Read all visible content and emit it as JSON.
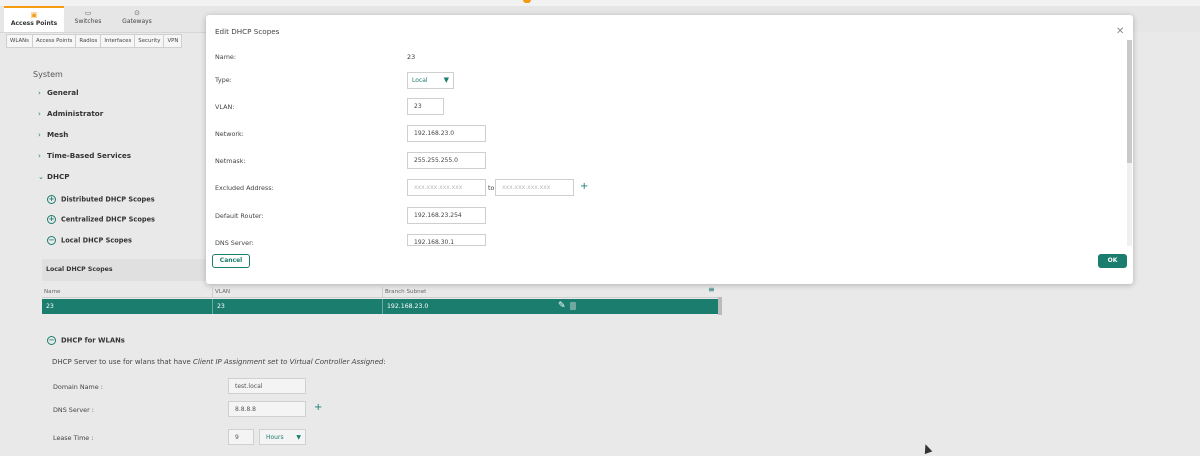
{
  "category_tabs": [
    {
      "label": "Access Points",
      "icon": "access-point-icon",
      "active": true
    },
    {
      "label": "Switches",
      "icon": "switch-icon",
      "active": false
    },
    {
      "label": "Gateways",
      "icon": "gateway-icon",
      "active": false
    }
  ],
  "sub_tabs": [
    "WLANs",
    "Access Points",
    "Radios",
    "Interfaces",
    "Security",
    "VPN"
  ],
  "left_panel": {
    "section_title": "System",
    "nav": [
      "General",
      "Administrator",
      "Mesh",
      "Time-Based Services",
      "DHCP"
    ],
    "dhcp_scopes": [
      "Distributed DHCP Scopes",
      "Centralized DHCP Scopes",
      "Local DHCP Scopes"
    ],
    "table": {
      "title": "Local DHCP Scopes",
      "columns": [
        "Name",
        "VLAN",
        "Branch Subnet"
      ],
      "rows": [
        [
          "23",
          "23",
          "192.168.23.0"
        ]
      ]
    },
    "wlans": {
      "title": "DHCP for WLANs",
      "desc_prefix": "DHCP Server to use for wlans that have ",
      "desc_emph": "Client IP Assignment set to Virtual Controller Assigned",
      "desc_suffix": ":",
      "domain_label": "Domain Name :",
      "domain_value": "test.local",
      "dns_label": "DNS Server :",
      "dns_value": "8.8.8.8",
      "lease_label": "Lease Time :",
      "lease_value": "9",
      "lease_unit": "Hours"
    }
  },
  "modal": {
    "title": "Edit DHCP Scopes",
    "fields": {
      "name_label": "Name:",
      "name_value": "23",
      "type_label": "Type:",
      "type_value": "Local",
      "vlan_label": "VLAN:",
      "vlan_value": "23",
      "network_label": "Network:",
      "network_value": "192.168.23.0",
      "netmask_label": "Netmask:",
      "netmask_value": "255.255.255.0",
      "excluded_label": "Excluded Address:",
      "excluded_from_placeholder": "xxx.xxx.xxx.xxx",
      "excluded_to_label": "to",
      "excluded_to_placeholder": "xxx.xxx.xxx.xxx",
      "router_label": "Default Router:",
      "router_value": "192.168.23.254",
      "dns_label": "DNS Server:",
      "dns_value": "192.168.30.1"
    },
    "cancel_label": "Cancel",
    "ok_label": "OK"
  },
  "colors": {
    "accent": "#1b7d6e",
    "active_tab": "#f39c12"
  }
}
